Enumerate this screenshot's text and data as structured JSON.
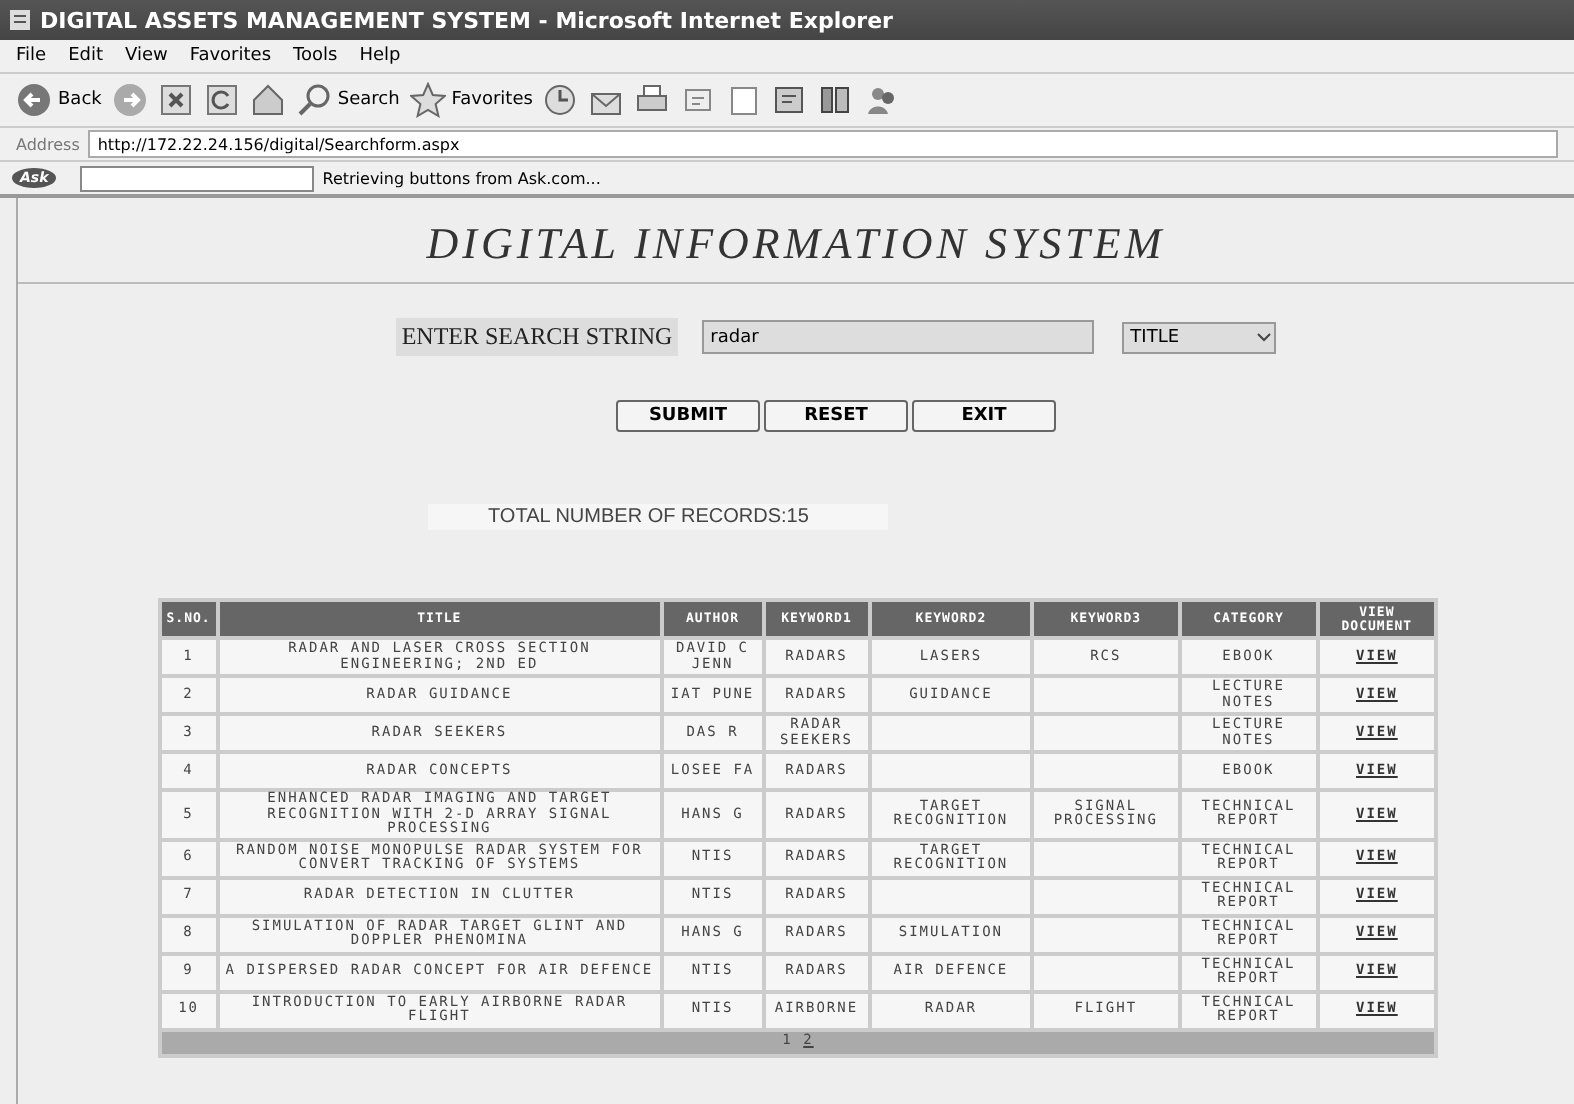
{
  "window": {
    "title": "DIGITAL ASSETS MANAGEMENT SYSTEM - Microsoft Internet Explorer"
  },
  "menu": [
    "File",
    "Edit",
    "View",
    "Favorites",
    "Tools",
    "Help"
  ],
  "toolbar": [
    {
      "kind": "back",
      "label": "Back"
    },
    {
      "kind": "forward"
    },
    {
      "kind": "stop"
    },
    {
      "kind": "refresh"
    },
    {
      "kind": "home"
    },
    {
      "kind": "search",
      "label": "Search"
    },
    {
      "kind": "favorites",
      "label": "Favorites"
    },
    {
      "kind": "history"
    },
    {
      "kind": "mail"
    },
    {
      "kind": "print"
    },
    {
      "kind": "edit"
    },
    {
      "kind": "note"
    },
    {
      "kind": "messenger"
    },
    {
      "kind": "research"
    },
    {
      "kind": "people"
    }
  ],
  "address": {
    "label": "Address",
    "url": "http://172.22.24.156/digital/Searchform.aspx"
  },
  "ask_bar": {
    "logo": "Ask",
    "status": "Retrieving buttons from Ask.com..."
  },
  "page": {
    "heading": "DIGITAL INFORMATION SYSTEM",
    "search": {
      "label": "ENTER SEARCH STRING",
      "value": "radar",
      "field": "TITLE"
    },
    "buttons": [
      "SUBMIT",
      "RESET",
      "EXIT"
    ],
    "total": "TOTAL NUMBER OF RECORDS:15",
    "table": {
      "columns": [
        "S.NO.",
        "TITLE",
        "AUTHOR",
        "KEYWORD1",
        "KEYWORD2",
        "KEYWORD3",
        "CATEGORY",
        "VIEW DOCUMENT"
      ],
      "rows": [
        [
          "1",
          "RADAR AND LASER CROSS SECTION ENGINEERING; 2ND ED",
          "DAVID C JENN",
          "RADARS",
          "LASERS",
          "RCS",
          "EBOOK",
          "VIEW"
        ],
        [
          "2",
          "RADAR GUIDANCE",
          "IAT PUNE",
          "RADARS",
          "GUIDANCE",
          "",
          "LECTURE NOTES",
          "VIEW"
        ],
        [
          "3",
          "RADAR SEEKERS",
          "DAS R",
          "RADAR SEEKERS",
          "",
          "",
          "LECTURE NOTES",
          "VIEW"
        ],
        [
          "4",
          "RADAR CONCEPTS",
          "LOSEE FA",
          "RADARS",
          "",
          "",
          "EBOOK",
          "VIEW"
        ],
        [
          "5",
          "ENHANCED RADAR IMAGING AND TARGET RECOGNITION WITH 2-D ARRAY SIGNAL PROCESSING",
          "HANS G",
          "RADARS",
          "TARGET RECOGNITION",
          "SIGNAL PROCESSING",
          "TECHNICAL REPORT",
          "VIEW"
        ],
        [
          "6",
          "RANDOM NOISE MONOPULSE RADAR SYSTEM FOR CONVERT TRACKING OF SYSTEMS",
          "NTIS",
          "RADARS",
          "TARGET RECOGNITION",
          "",
          "TECHNICAL REPORT",
          "VIEW"
        ],
        [
          "7",
          "RADAR DETECTION IN CLUTTER",
          "NTIS",
          "RADARS",
          "",
          "",
          "TECHNICAL REPORT",
          "VIEW"
        ],
        [
          "8",
          "SIMULATION OF RADAR TARGET GLINT AND DOPPLER PHENOMINA",
          "HANS G",
          "RADARS",
          "SIMULATION",
          "",
          "TECHNICAL REPORT",
          "VIEW"
        ],
        [
          "9",
          "A DISPERSED RADAR CONCEPT FOR AIR DEFENCE",
          "NTIS",
          "RADARS",
          "AIR DEFENCE",
          "",
          "TECHNICAL REPORT",
          "VIEW"
        ],
        [
          "10",
          "INTRODUCTION TO EARLY AIRBORNE RADAR FLIGHT",
          "NTIS",
          "AIRBORNE",
          "RADAR",
          "FLIGHT",
          "TECHNICAL REPORT",
          "VIEW"
        ]
      ],
      "pages": [
        {
          "label": "1",
          "selected": true
        },
        {
          "label": "2",
          "selected": false
        }
      ]
    }
  }
}
